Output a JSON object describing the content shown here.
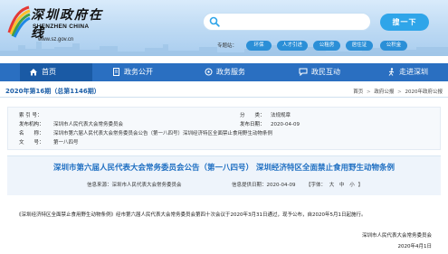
{
  "header": {
    "logo_cn": "深圳政府在线",
    "logo_en": "SHENZHEN CHINA",
    "logo_url": "www.sz.gov.cn",
    "search_placeholder": "",
    "search_button": "搜一下",
    "quick_label": "专题站：",
    "quick_links": [
      "环保",
      "人才引进",
      "公租房",
      "居住证",
      "公积金"
    ]
  },
  "nav": {
    "items": [
      "首页",
      "政务公开",
      "政务服务",
      "政民互动",
      "走进深圳"
    ]
  },
  "issue": {
    "number": "2020年第16期（总第1146期）",
    "breadcrumb": [
      "首页",
      "政府公报",
      "2020年政府公报"
    ]
  },
  "info": {
    "index_label": "索 引 号：",
    "index_value": "",
    "category_label": "分　　类：",
    "category_value": "法规规章",
    "publisher_label": "发布机构：",
    "publisher_value": "深圳市人民代表大会常务委员会",
    "date_label": "发布日期：",
    "date_value": "2020-04-09",
    "name_label": "名　　称：",
    "name_value": "深圳市第六届人民代表大会常务委员会公告（第一八四号）深圳经济特区全面禁止食用野生动物条例",
    "docno_label": "文　　号：",
    "docno_value": "第一八四号"
  },
  "article": {
    "title": "深圳市第六届人民代表大会常务委员会公告（第一八四号）  深圳经济特区全面禁止食用野生动物条例",
    "source_label": "信息来源：",
    "source_value": "深圳市人民代表大会常务委员会",
    "provided_label": "信息提供日期：",
    "provided_value": "2020-04-09",
    "font_label": "【字体：",
    "font_sizes": [
      "大",
      "中",
      "小"
    ],
    "font_close": "】",
    "body": "《深圳经济特区全面禁止食用野生动物条例》经市第六届人民代表大会常务委员会第四十次会议于2020年3月31日通过，现予公布，自2020年5月1日起施行。",
    "sign_org": "深圳市人民代表大会常务委员会",
    "sign_date": "2020年4月1日"
  },
  "colors": {
    "nav_bg": "#2a6fc1",
    "accent": "#2fa5e9",
    "title_blue": "#1f6fc2"
  }
}
